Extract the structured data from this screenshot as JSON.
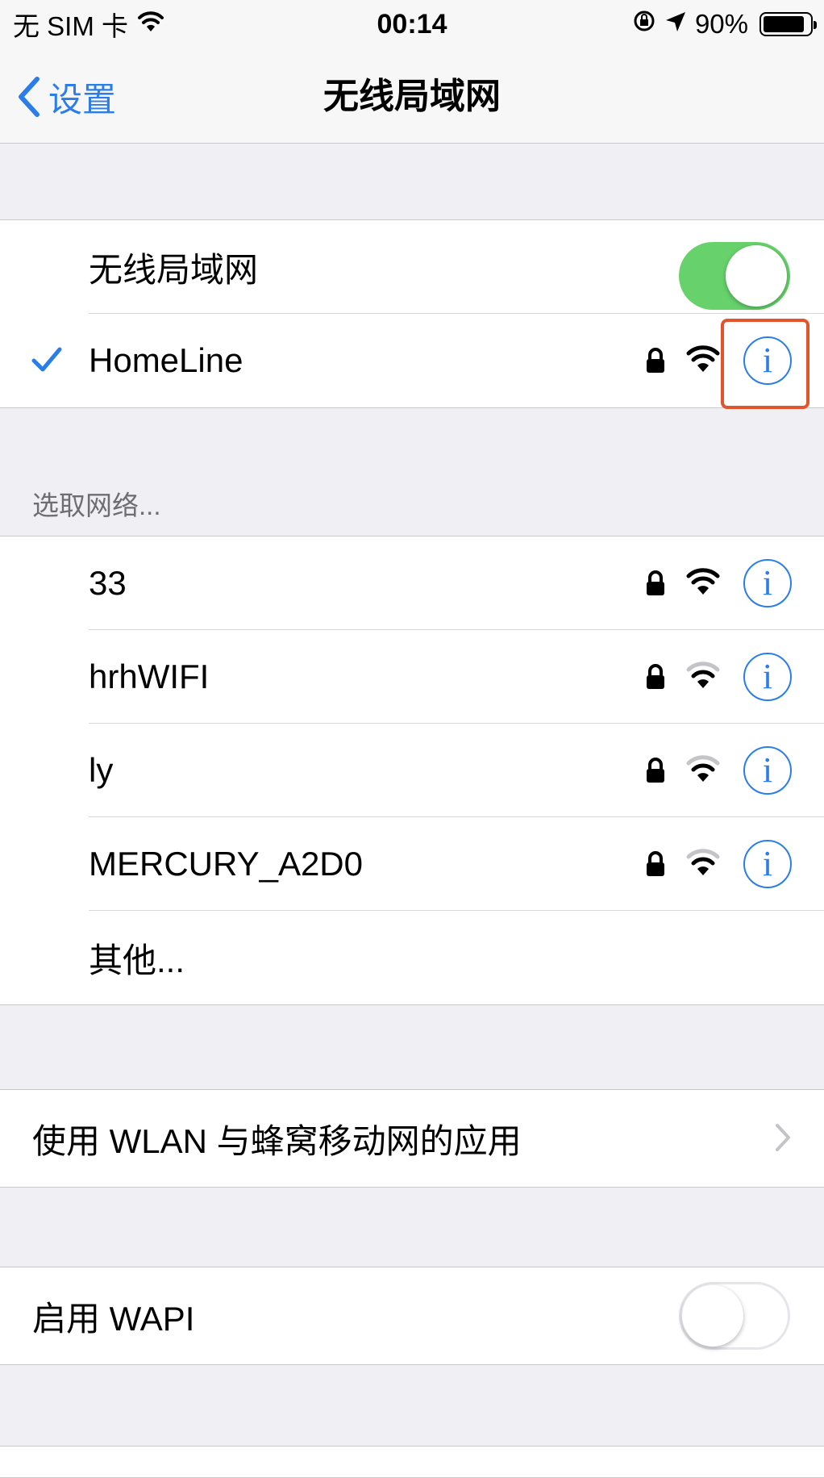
{
  "status_bar": {
    "carrier": "无 SIM 卡",
    "time": "00:14",
    "battery": "90%",
    "battery_level": 0.9
  },
  "nav": {
    "back_label": "设置",
    "title": "无线局域网"
  },
  "wifi_section": {
    "toggle_label": "无线局域网",
    "toggle_on": true,
    "connected_network": "HomeLine"
  },
  "choose_network_header": "选取网络...",
  "networks": [
    {
      "name": "33",
      "locked": true,
      "signal": 3
    },
    {
      "name": "hrhWIFI",
      "locked": true,
      "signal": 2
    },
    {
      "name": "ly",
      "locked": true,
      "signal": 2
    },
    {
      "name": "MERCURY_A2D0",
      "locked": true,
      "signal": 2
    }
  ],
  "other_label": "其他...",
  "apps_row_label": "使用 WLAN 与蜂窝移动网的应用",
  "wapi": {
    "label": "启用 WAPI",
    "on": false
  },
  "info_glyph": "i",
  "colors": {
    "accent": "#2b7de9",
    "toggle_on": "#67d26b",
    "highlight": "#e2552c"
  }
}
